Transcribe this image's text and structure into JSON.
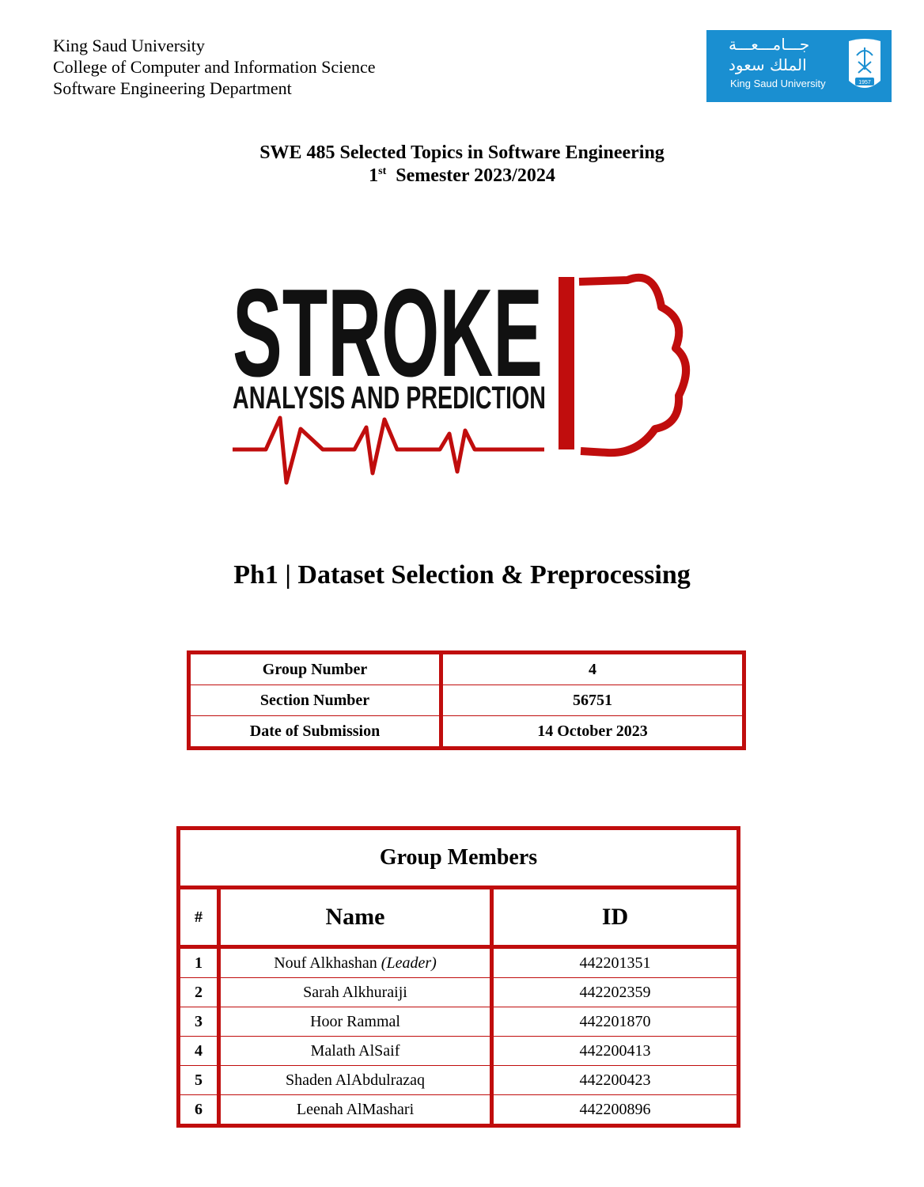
{
  "header": {
    "university": "King Saud University",
    "college": "College of Computer and Information Science",
    "department": "Software Engineering Department"
  },
  "ksu_logo": {
    "arabic_line1": "جـــامـــعـــة",
    "arabic_line2": "الملك سعود",
    "english": "King Saud University",
    "year": "1957",
    "color": "#1a8fd1"
  },
  "course": {
    "title": "SWE 485 Selected Topics in Software Engineering",
    "semester_num": "1",
    "semester_sup": "st",
    "semester_rest": "Semester 2023/2024"
  },
  "stroke_logo": {
    "word": "STROKE",
    "tagline": "ANALYSIS AND PREDICTION",
    "accent": "#c00d0d"
  },
  "phase_title": "Ph1 | Dataset Selection & Preprocessing",
  "info": [
    {
      "label": "Group Number",
      "value": "4"
    },
    {
      "label": "Section Number",
      "value": "56751"
    },
    {
      "label": "Date of Submission",
      "value": "14 October 2023"
    }
  ],
  "members": {
    "title": "Group Members",
    "headers": {
      "num": "#",
      "name": "Name",
      "id": "ID"
    },
    "rows": [
      {
        "num": "1",
        "name": "Nouf Alkhashan",
        "note": "(Leader)",
        "id": "442201351"
      },
      {
        "num": "2",
        "name": "Sarah Alkhuraiji",
        "note": "",
        "id": "442202359"
      },
      {
        "num": "3",
        "name": "Hoor Rammal",
        "note": "",
        "id": "442201870"
      },
      {
        "num": "4",
        "name": "Malath AlSaif",
        "note": "",
        "id": "442200413"
      },
      {
        "num": "5",
        "name": "Shaden AlAbdulrazaq",
        "note": "",
        "id": "442200423"
      },
      {
        "num": "6",
        "name": "Leenah AlMashari",
        "note": "",
        "id": "442200896"
      }
    ]
  },
  "border_color": "#c00d0d"
}
